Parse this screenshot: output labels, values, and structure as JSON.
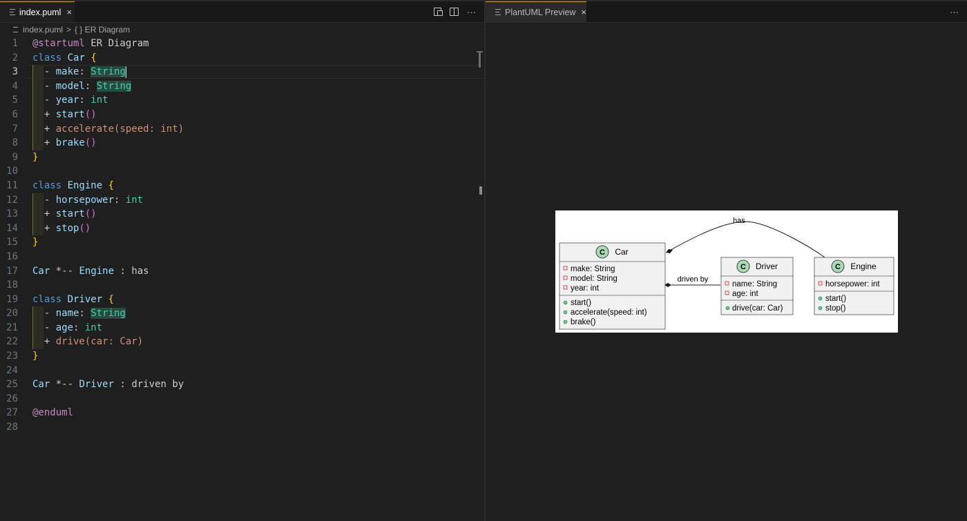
{
  "editor": {
    "tab": {
      "label": "index.puml",
      "close": "×"
    },
    "actions": {
      "more": "···"
    },
    "breadcrumb": {
      "file": "index.puml",
      "separator": ">",
      "symbol": "{ } ER Diagram"
    },
    "lines": [
      {
        "n": "1",
        "tokens": [
          {
            "t": "@startuml",
            "c": "dir"
          },
          {
            "t": " ER Diagram",
            "c": "op"
          }
        ]
      },
      {
        "n": "2",
        "tokens": [
          {
            "t": "class",
            "c": "kw"
          },
          {
            "t": " "
          },
          {
            "t": "Car",
            "c": "cls"
          },
          {
            "t": " "
          },
          {
            "t": "{",
            "c": "brace"
          }
        ]
      },
      {
        "n": "3",
        "guide": true,
        "current": true,
        "tokens": [
          {
            "t": "  - ",
            "c": "op"
          },
          {
            "t": "make",
            "c": "prop"
          },
          {
            "t": ": ",
            "c": "op"
          },
          {
            "t": "String",
            "c": "typehl"
          },
          {
            "cursor": true
          }
        ]
      },
      {
        "n": "4",
        "guide": true,
        "tokens": [
          {
            "t": "  - ",
            "c": "op"
          },
          {
            "t": "model",
            "c": "prop"
          },
          {
            "t": ": ",
            "c": "op"
          },
          {
            "t": "String",
            "c": "typehl"
          }
        ]
      },
      {
        "n": "5",
        "guide": true,
        "tokens": [
          {
            "t": "  - ",
            "c": "op"
          },
          {
            "t": "year",
            "c": "prop"
          },
          {
            "t": ": ",
            "c": "op"
          },
          {
            "t": "int",
            "c": "type"
          }
        ]
      },
      {
        "n": "6",
        "guide": true,
        "tokens": [
          {
            "t": "  + ",
            "c": "op"
          },
          {
            "t": "start",
            "c": "mth"
          },
          {
            "t": "()",
            "c": "paren"
          }
        ]
      },
      {
        "n": "7",
        "guide": true,
        "tokens": [
          {
            "t": "  + ",
            "c": "op"
          },
          {
            "t": "accelerate(speed: int)",
            "c": "arg"
          }
        ]
      },
      {
        "n": "8",
        "guide": true,
        "tokens": [
          {
            "t": "  + ",
            "c": "op"
          },
          {
            "t": "brake",
            "c": "mth"
          },
          {
            "t": "()",
            "c": "paren"
          }
        ]
      },
      {
        "n": "9",
        "tokens": [
          {
            "t": "}",
            "c": "brace"
          }
        ]
      },
      {
        "n": "10",
        "tokens": []
      },
      {
        "n": "11",
        "tokens": [
          {
            "t": "class",
            "c": "kw"
          },
          {
            "t": " "
          },
          {
            "t": "Engine",
            "c": "cls"
          },
          {
            "t": " "
          },
          {
            "t": "{",
            "c": "brace"
          }
        ]
      },
      {
        "n": "12",
        "guide": true,
        "tokens": [
          {
            "t": "  - ",
            "c": "op"
          },
          {
            "t": "horsepower",
            "c": "prop"
          },
          {
            "t": ": ",
            "c": "op"
          },
          {
            "t": "int",
            "c": "type"
          }
        ]
      },
      {
        "n": "13",
        "guide": true,
        "tokens": [
          {
            "t": "  + ",
            "c": "op"
          },
          {
            "t": "start",
            "c": "mth"
          },
          {
            "t": "()",
            "c": "paren"
          }
        ]
      },
      {
        "n": "14",
        "guide": true,
        "tokens": [
          {
            "t": "  + ",
            "c": "op"
          },
          {
            "t": "stop",
            "c": "mth"
          },
          {
            "t": "()",
            "c": "paren"
          }
        ]
      },
      {
        "n": "15",
        "tokens": [
          {
            "t": "}",
            "c": "brace"
          }
        ]
      },
      {
        "n": "16",
        "tokens": []
      },
      {
        "n": "17",
        "tokens": [
          {
            "t": "Car",
            "c": "rel"
          },
          {
            "t": " *-- ",
            "c": "op"
          },
          {
            "t": "Engine",
            "c": "rel"
          },
          {
            "t": " : has",
            "c": "op"
          }
        ]
      },
      {
        "n": "18",
        "tokens": []
      },
      {
        "n": "19",
        "tokens": [
          {
            "t": "class",
            "c": "kw"
          },
          {
            "t": " "
          },
          {
            "t": "Driver",
            "c": "cls"
          },
          {
            "t": " "
          },
          {
            "t": "{",
            "c": "brace"
          }
        ]
      },
      {
        "n": "20",
        "guide": true,
        "tokens": [
          {
            "t": "  - ",
            "c": "op"
          },
          {
            "t": "name",
            "c": "prop"
          },
          {
            "t": ": ",
            "c": "op"
          },
          {
            "t": "String",
            "c": "typehl"
          }
        ]
      },
      {
        "n": "21",
        "guide": true,
        "tokens": [
          {
            "t": "  - ",
            "c": "op"
          },
          {
            "t": "age",
            "c": "prop"
          },
          {
            "t": ": ",
            "c": "op"
          },
          {
            "t": "int",
            "c": "type"
          }
        ]
      },
      {
        "n": "22",
        "guide": true,
        "tokens": [
          {
            "t": "  + ",
            "c": "op"
          },
          {
            "t": "drive(car: Car)",
            "c": "arg"
          }
        ]
      },
      {
        "n": "23",
        "tokens": [
          {
            "t": "}",
            "c": "brace"
          }
        ]
      },
      {
        "n": "24",
        "tokens": []
      },
      {
        "n": "25",
        "tokens": [
          {
            "t": "Car",
            "c": "rel"
          },
          {
            "t": " *-- ",
            "c": "op"
          },
          {
            "t": "Driver",
            "c": "rel"
          },
          {
            "t": " : driven by",
            "c": "op"
          }
        ]
      },
      {
        "n": "26",
        "tokens": []
      },
      {
        "n": "27",
        "tokens": [
          {
            "t": "@enduml",
            "c": "dir"
          }
        ]
      },
      {
        "n": "28",
        "tokens": []
      }
    ]
  },
  "preview": {
    "tab": {
      "label": "PlantUML Preview",
      "close": "×"
    },
    "actions": {
      "more": "···"
    },
    "diagram": {
      "circle_letter": "C",
      "classes": {
        "car": {
          "name": "Car",
          "fields": [
            "make: String",
            "model: String",
            "year: int"
          ],
          "methods": [
            "start()",
            "accelerate(speed: int)",
            "brake()"
          ]
        },
        "driver": {
          "name": "Driver",
          "fields": [
            "name: String",
            "age: int"
          ],
          "methods": [
            "drive(car: Car)"
          ]
        },
        "engine": {
          "name": "Engine",
          "fields": [
            "horsepower: int"
          ],
          "methods": [
            "start()",
            "stop()"
          ]
        }
      },
      "relations": {
        "has": "has",
        "driven_by": "driven by"
      }
    }
  },
  "colors": {
    "tab_accent": "#d6a13a",
    "circle_fill": "#a9d9b5",
    "box_fill": "#f1f1f1"
  }
}
